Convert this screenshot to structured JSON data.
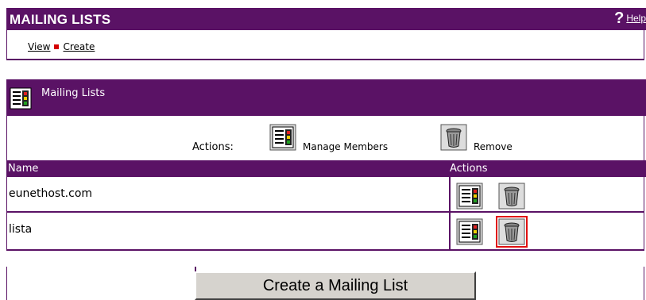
{
  "header": {
    "title": "MAILING LISTS",
    "help_q": "?",
    "help_label": "Help"
  },
  "subnav": {
    "view": "View",
    "create": "Create"
  },
  "panel": {
    "title": "Mailing Lists"
  },
  "actions_bar": {
    "label": "Actions:",
    "manage": "Manage Members",
    "remove": "Remove"
  },
  "table": {
    "columns": [
      "Name",
      "Actions"
    ],
    "rows": [
      {
        "name": "eunethost.com"
      },
      {
        "name": "lista"
      }
    ]
  },
  "footer": {
    "create_button": "Create a Mailing List"
  },
  "colors": {
    "brand": "#5a1265",
    "selected_outline": "#e01010"
  },
  "icons": {
    "manage": "members-list-icon",
    "remove": "trash-can-icon"
  }
}
